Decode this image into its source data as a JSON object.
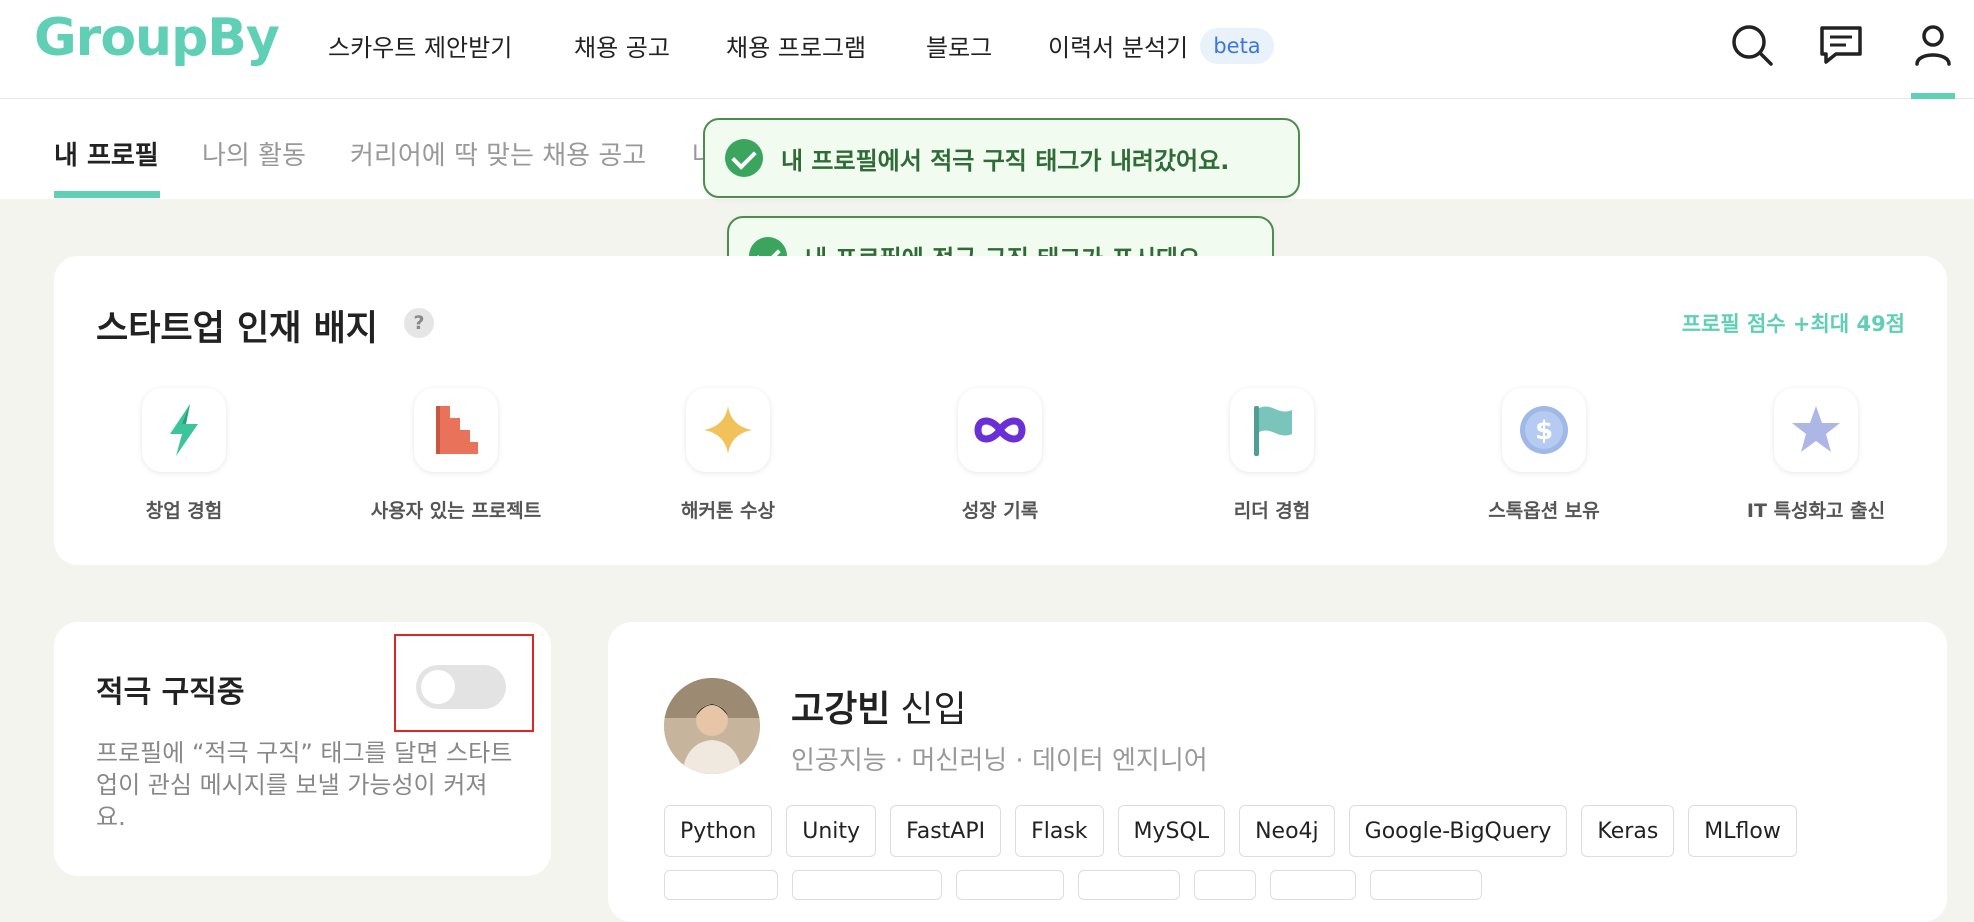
{
  "header": {
    "logo": "GroupBy",
    "nav": [
      "스카우트 제안받기",
      "채용 공고",
      "채용 프로그램",
      "블로그",
      "이력서 분석기"
    ],
    "beta_badge": "beta",
    "icons": [
      "search-icon",
      "chat-icon",
      "user-icon"
    ]
  },
  "tabs": [
    "내 프로필",
    "나의 활동",
    "커리어에 딱 맞는 채용 공고",
    "나"
  ],
  "toasts": [
    "내 프로필에서 적극 구직 태그가 내려갔어요.",
    "내 프로필에 적극 구직 태그가 표시돼요."
  ],
  "badges_card": {
    "title": "스타트업 인재 배지",
    "help": "?",
    "score": "프로필 점수 +최대 49점",
    "badges": [
      {
        "label": "창업 경험",
        "icon": "lightning-icon"
      },
      {
        "label": "사용자 있는 프로젝트",
        "icon": "stairs-icon"
      },
      {
        "label": "해커톤 수상",
        "icon": "sparkle-icon"
      },
      {
        "label": "성장 기록",
        "icon": "infinity-icon"
      },
      {
        "label": "리더 경험",
        "icon": "flag-icon"
      },
      {
        "label": "스톡옵션 보유",
        "icon": "dollar-coin-icon"
      },
      {
        "label": "IT 특성화고 출신",
        "icon": "star-icon"
      }
    ]
  },
  "job_search": {
    "title": "적극 구직중",
    "toggle_on": false,
    "description": "프로필에 “적극 구직” 태그를 달면 스타트업이 관심 메시지를 보낼 가능성이 커져요."
  },
  "profile": {
    "name": "고강빈",
    "level": "신입",
    "subtitle": "인공지능 · 머신러닝 · 데이터 엔지니어",
    "tags": [
      "Python",
      "Unity",
      "FastAPI",
      "Flask",
      "MySQL",
      "Neo4j",
      "Google-BigQuery",
      "Keras",
      "MLflow"
    ]
  },
  "colors": {
    "accent": "#5fcfb5",
    "toast_bg": "#f2fbef",
    "toast_border": "#4e8b4f",
    "highlight": "#e0271f"
  }
}
